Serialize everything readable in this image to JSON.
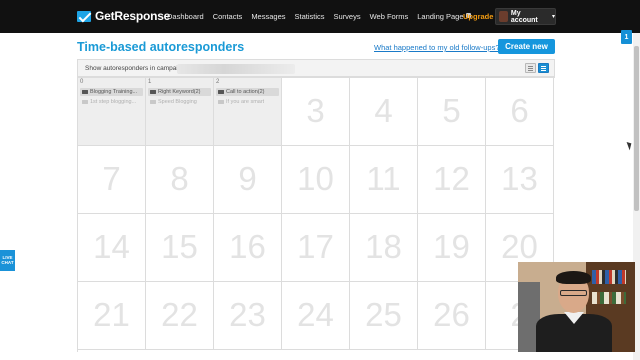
{
  "brand": {
    "logo_text": "GetResponse",
    "accent_color": "#1596dd"
  },
  "nav": {
    "items": [
      "Dashboard",
      "Contacts",
      "Messages",
      "Statistics",
      "Surveys",
      "Web Forms",
      "Landing Page"
    ],
    "upgrade_label": "Upgrade",
    "account_label": "My account"
  },
  "header": {
    "title": "Time-based autoresponders",
    "help_link": "What happened to my old follow-ups?",
    "create_label": "Create new"
  },
  "campaign_bar": {
    "label": "Show autoresponders in campaign:"
  },
  "calendar": {
    "days": [
      {
        "small": "0",
        "messages": [
          {
            "text": "Blogging Training...",
            "muted": false
          },
          {
            "text": "1st step blogging...",
            "muted": true
          }
        ]
      },
      {
        "small": "1",
        "messages": [
          {
            "text": "Right Keyword(2)",
            "muted": false
          },
          {
            "text": "Speed Blogging",
            "muted": true
          }
        ]
      },
      {
        "small": "2",
        "messages": [
          {
            "text": "Call to action(2)",
            "muted": false
          },
          {
            "text": "If you are smart",
            "muted": true
          }
        ]
      },
      {
        "big": "3"
      },
      {
        "big": "4"
      },
      {
        "big": "5"
      },
      {
        "big": "6"
      },
      {
        "big": "7"
      },
      {
        "big": "8"
      },
      {
        "big": "9"
      },
      {
        "big": "10"
      },
      {
        "big": "11"
      },
      {
        "big": "12"
      },
      {
        "big": "13"
      },
      {
        "big": "14"
      },
      {
        "big": "15"
      },
      {
        "big": "16"
      },
      {
        "big": "17"
      },
      {
        "big": "18"
      },
      {
        "big": "19"
      },
      {
        "big": "20"
      },
      {
        "big": "21"
      },
      {
        "big": "22"
      },
      {
        "big": "23"
      },
      {
        "big": "24"
      },
      {
        "big": "25"
      },
      {
        "big": "26"
      },
      {
        "big": "2"
      }
    ]
  },
  "side_badge": "1",
  "live_chat": {
    "line1": "LIVE",
    "line2": "CHAT"
  }
}
